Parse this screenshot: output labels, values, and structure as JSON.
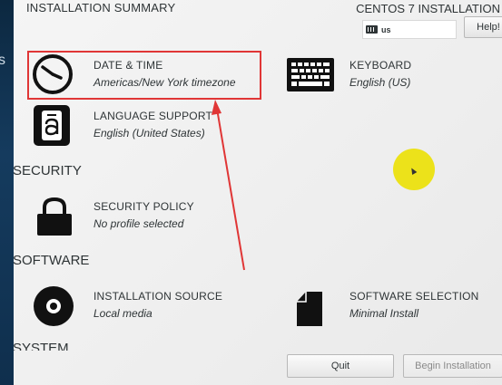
{
  "left_bar": {
    "glyph": "s"
  },
  "header": {
    "title": "INSTALLATION SUMMARY",
    "product": "CENTOS 7 INSTALLATION",
    "keyboard_indicator": "us",
    "help_label": "Help!"
  },
  "sections": {
    "localization": {
      "spokes": {
        "date_time": {
          "title": "DATE & TIME",
          "status": "Americas/New York timezone",
          "icon": "clock-icon"
        },
        "keyboard": {
          "title": "KEYBOARD",
          "status": "English (US)",
          "icon": "keyboard-icon"
        },
        "language": {
          "title": "LANGUAGE SUPPORT",
          "status": "English (United States)",
          "icon": "language-icon"
        }
      }
    },
    "security": {
      "heading": "SECURITY",
      "spokes": {
        "security_policy": {
          "title": "SECURITY POLICY",
          "status": "No profile selected",
          "icon": "lock-icon"
        }
      }
    },
    "software": {
      "heading": "SOFTWARE",
      "spokes": {
        "installation_source": {
          "title": "INSTALLATION SOURCE",
          "status": "Local media",
          "icon": "disc-icon"
        },
        "software_selection": {
          "title": "SOFTWARE SELECTION",
          "status": "Minimal Install",
          "icon": "package-icon"
        }
      }
    },
    "system": {
      "heading": "SYSTEM"
    }
  },
  "footer": {
    "quit_label": "Quit",
    "begin_label": "Begin Installation"
  },
  "colors": {
    "annotation": "#e03636",
    "cursor_highlight": "#ece21a",
    "left_bar": "#153b5e"
  }
}
